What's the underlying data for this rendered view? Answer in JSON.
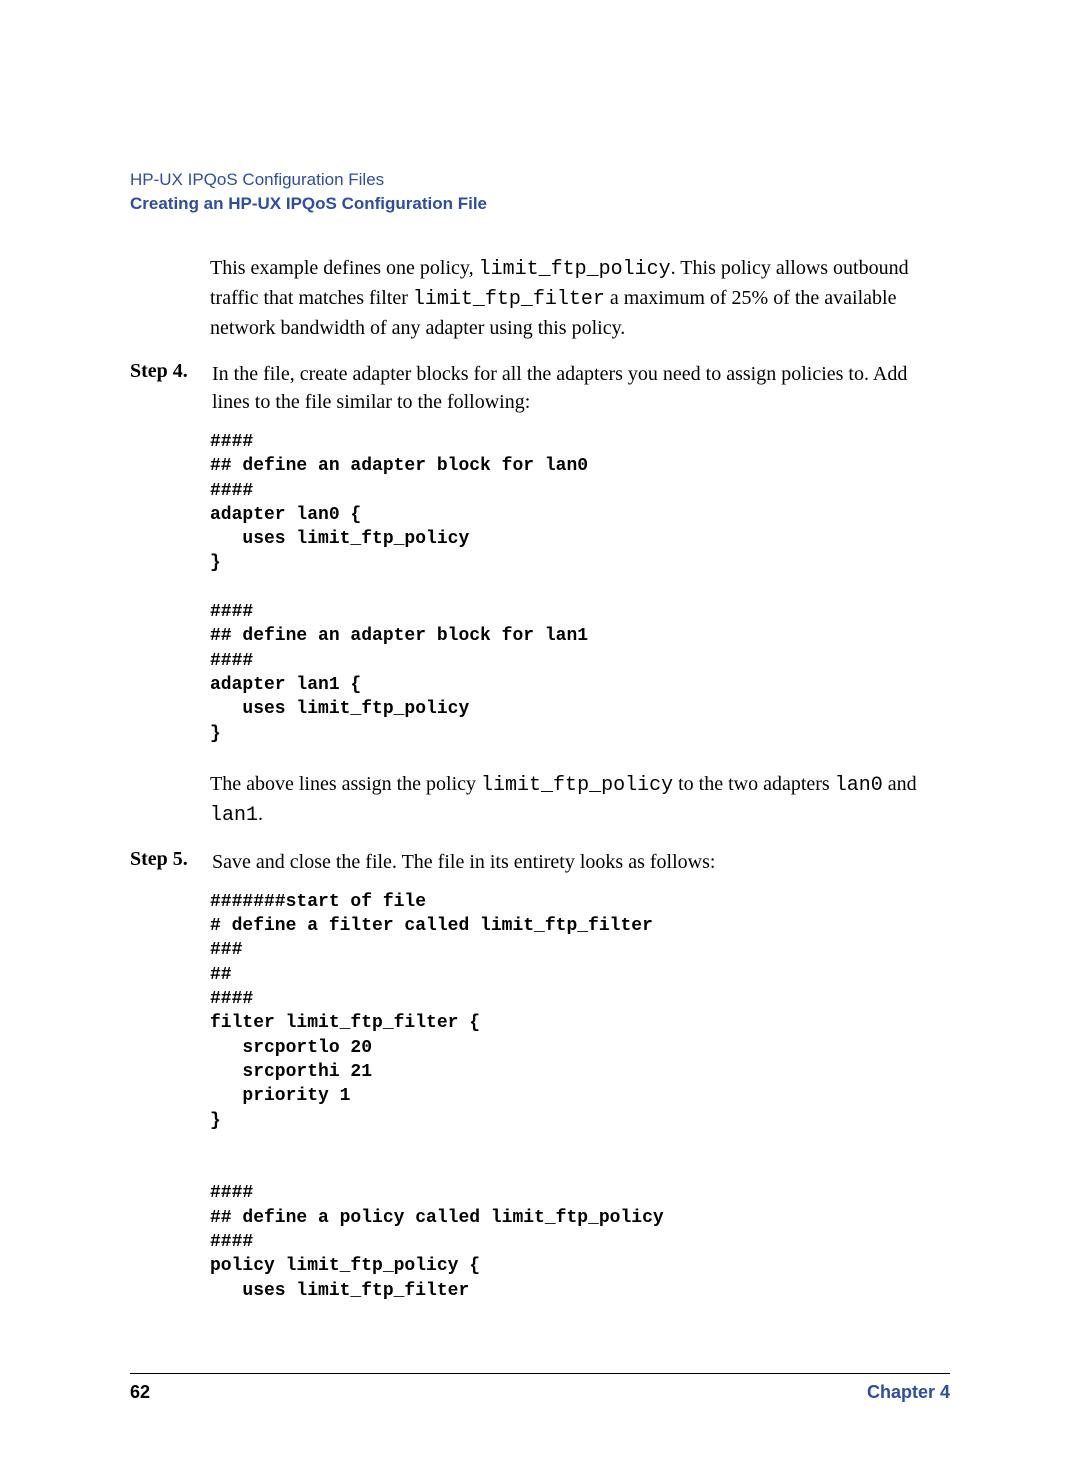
{
  "header": {
    "breadcrumb": "HP-UX IPQoS Configuration Files",
    "subtitle": "Creating an HP-UX IPQoS Configuration File"
  },
  "intro": {
    "before_code1": "This example defines one policy, ",
    "code1": "limit_ftp_policy",
    "mid1": ". This policy allows outbound traffic that matches filter ",
    "code2": "limit_ftp_filter",
    "after_code2": " a maximum of 25% of the available network bandwidth of any adapter using this policy."
  },
  "step4": {
    "label": "Step   4.",
    "text": "In the file, create adapter blocks for all the adapters you need to assign policies to. Add lines to the file similar to the following:",
    "code": "####\n## define an adapter block for lan0\n####\nadapter lan0 {\n   uses limit_ftp_policy\n}\n\n####\n## define an adapter block for lan1\n####\nadapter lan1 {\n   uses limit_ftp_policy\n}",
    "after_before": "The above lines assign the policy ",
    "after_code1": "limit_ftp_policy",
    "after_mid": " to the two adapters ",
    "after_code2": "lan0",
    "after_and": " and ",
    "after_code3": "lan1",
    "after_end": "."
  },
  "step5": {
    "label": "Step   5.",
    "text": "Save and close the file. The file in its entirety looks as follows:",
    "code": "#######start of file\n# define a filter called limit_ftp_filter\n###\n##\n####\nfilter limit_ftp_filter {\n   srcportlo 20\n   srcporthi 21\n   priority 1\n}\n\n\n####\n## define a policy called limit_ftp_policy\n####\npolicy limit_ftp_policy {\n   uses limit_ftp_filter"
  },
  "footer": {
    "page_number": "62",
    "chapter": "Chapter 4"
  }
}
